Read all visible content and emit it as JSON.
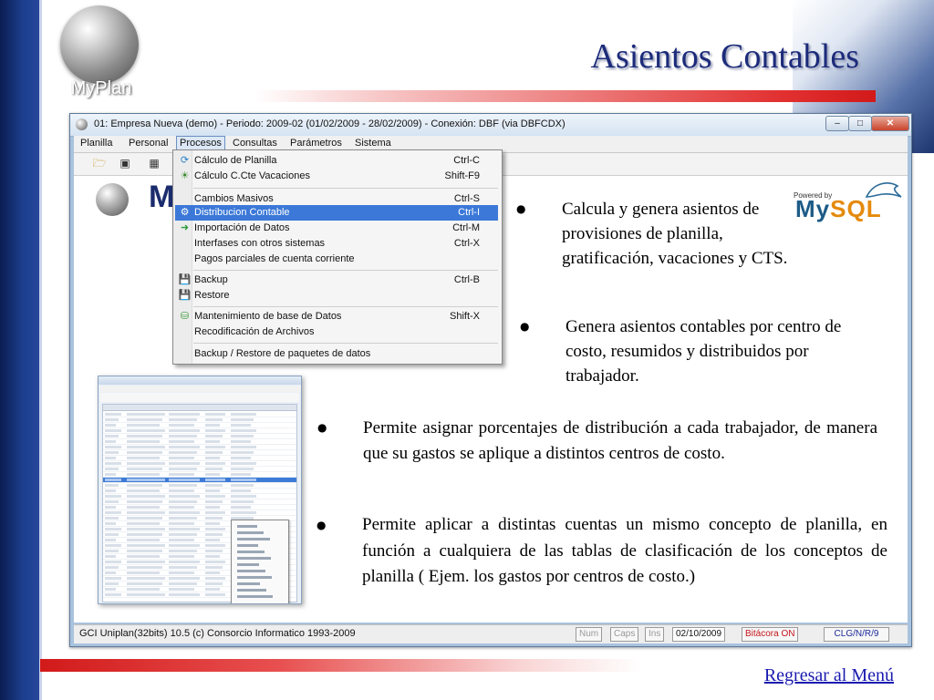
{
  "slide": {
    "logo_text": "MyPlan",
    "title": "Asientos Contables",
    "back_link": "Regresar al Menú"
  },
  "window": {
    "title": "01: Empresa Nueva  (demo)  - Periodo: 2009-02 (01/02/2009 - 28/02/2009) - Conexión: DBF (via DBFCDX)",
    "controls": [
      "minimize",
      "maximize",
      "close"
    ],
    "menu": [
      {
        "label": "Planilla",
        "active": false
      },
      {
        "label": "Personal",
        "active": false
      },
      {
        "label": "Procesos",
        "active": true
      },
      {
        "label": "Consultas",
        "active": false
      },
      {
        "label": "Parámetros",
        "active": false
      },
      {
        "label": "Sistema",
        "active": false
      }
    ],
    "toolbar_icons": [
      "folder-icon",
      "window-icon",
      "grid-icon"
    ],
    "status": {
      "left": "GCI Uniplan(32bits) 10.5  (c) Consorcio Informatico 1993-2009",
      "num": "Num",
      "caps": "Caps",
      "ins": "Ins",
      "date": "02/10/2009",
      "bitacora": "Bitácora ON",
      "code": "CLG/N/R/9"
    }
  },
  "procesos_menu": {
    "groups": [
      [
        {
          "label": "Cálculo de Planilla",
          "shortcut": "Ctrl-C",
          "icon": "calc-icon",
          "highlighted": false
        },
        {
          "label": "Cálculo C.Cte Vacaciones",
          "shortcut": "Shift-F9",
          "icon": "vacation-icon",
          "highlighted": false
        }
      ],
      [
        {
          "label": "Cambios Masivos",
          "shortcut": "Ctrl-S",
          "icon": "",
          "highlighted": false
        },
        {
          "label": "Distribucion Contable",
          "shortcut": "Ctrl-I",
          "icon": "distribution-icon",
          "highlighted": true
        },
        {
          "label": "Importación de Datos",
          "shortcut": "Ctrl-M",
          "icon": "import-icon",
          "highlighted": false
        },
        {
          "label": "Interfases con otros sistemas",
          "shortcut": "Ctrl-X",
          "icon": "",
          "highlighted": false
        },
        {
          "label": "Pagos parciales de cuenta corriente",
          "shortcut": "",
          "icon": "",
          "highlighted": false
        }
      ],
      [
        {
          "label": "Backup",
          "shortcut": "Ctrl-B",
          "icon": "save-icon",
          "highlighted": false
        },
        {
          "label": "Restore",
          "shortcut": "",
          "icon": "save-icon",
          "highlighted": false
        }
      ],
      [
        {
          "label": "Mantenimiento de base de Datos",
          "shortcut": "Shift-X",
          "icon": "database-icon",
          "highlighted": false
        },
        {
          "label": "Recodificación de Archivos",
          "shortcut": "",
          "icon": "",
          "highlighted": false
        }
      ],
      [
        {
          "label": "Backup / Restore de paquetes de datos",
          "shortcut": "",
          "icon": "",
          "highlighted": false
        }
      ]
    ]
  },
  "mysql_logo": {
    "powered_by": "Powered by",
    "word_my": "My",
    "word_sql": "SQL"
  },
  "bullets": [
    {
      "text": "Calcula y genera asientos de provisiones de planilla, gratificación, vacaciones y CTS."
    },
    {
      "text": "Genera asientos contables por centro de costo, resumidos y distribuidos por trabajador."
    },
    {
      "text": "Permite asignar porcentajes de distribución a cada trabajador, de manera que su gastos se aplique a distintos centros de costo."
    },
    {
      "text": "Permite aplicar a distintas cuentas un mismo concepto de planilla, en función a cualquiera de las tablas de clasificación de los conceptos de planilla ( Ejem. los gastos por centros de costo.)"
    }
  ],
  "colors": {
    "title": "#1c2b7a",
    "accent_red": "#d21a1a",
    "menu_highlight": "#3b78d8",
    "link": "#1a1ab0"
  }
}
